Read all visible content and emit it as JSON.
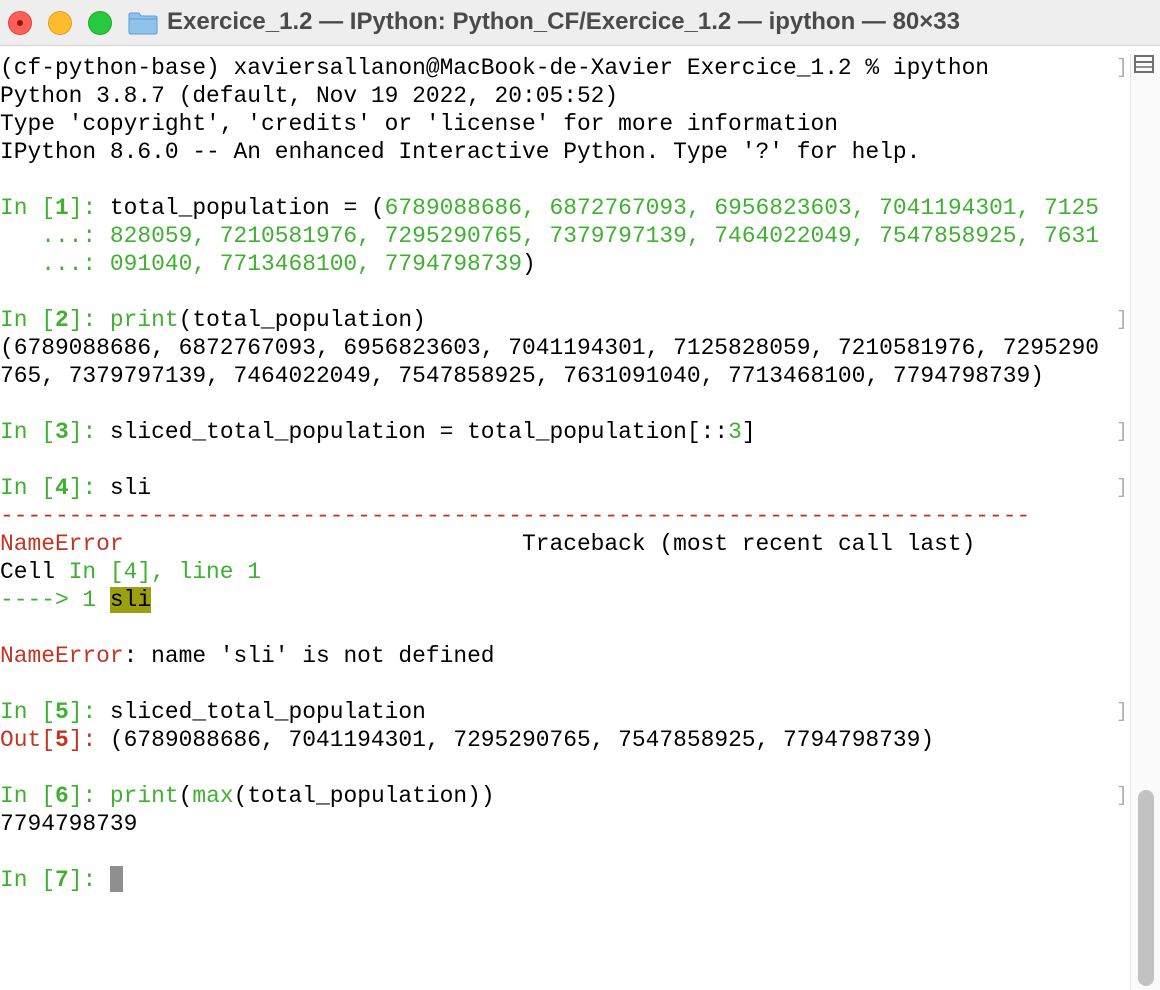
{
  "window": {
    "title": "Exercice_1.2 — IPython: Python_CF/Exercice_1.2 — ipython — 80×33"
  },
  "terminal": {
    "shell_prompt": "(cf-python-base) xaviersallanon@MacBook-de-Xavier Exercice_1.2 % ipython",
    "banner": [
      "Python 3.8.7 (default, Nov 19 2022, 20:05:52)",
      "Type 'copyright', 'credits' or 'license' for more information",
      "IPython 8.6.0 -- An enhanced Interactive Python. Type '?' for help."
    ],
    "cell1": {
      "prompt_in": "In [",
      "number": "1",
      "prompt_close": "]: ",
      "code1_pre": "total_population = (",
      "code1_nums": "6789088686, 6872767093, 6956823603, 7041194301, 7125",
      "cont_prompt": "   ...: ",
      "code2": "828059, 7210581976, 7295290765, 7379797139, 7464022049, 7547858925, 7631",
      "code3_nums": "091040, 7713468100, 7794798739",
      "code3_post": ")"
    },
    "cell2": {
      "prompt_in": "In [",
      "number": "2",
      "prompt_close": "]: ",
      "code_func": "print",
      "code_rest": "(total_population)",
      "output1": "(6789088686, 6872767093, 6956823603, 7041194301, 7125828059, 7210581976, 7295290",
      "output2": "765, 7379797139, 7464022049, 7547858925, 7631091040, 7713468100, 7794798739)"
    },
    "cell3": {
      "prompt_in": "In [",
      "number": "3",
      "prompt_close": "]: ",
      "code_pre": "sliced_total_population = total_population[::",
      "code_num": "3",
      "code_post": "]"
    },
    "cell4": {
      "prompt_in": "In [",
      "number": "4",
      "prompt_close": "]: ",
      "code": "sli",
      "rule": "---------------------------------------------------------------------------",
      "error_name": "NameError",
      "traceback_header": "                             Traceback (most recent call last)",
      "cell_label": "Cell ",
      "cell_ref": "In [4], line 1",
      "arrow": "----> 1 ",
      "arrow_code": "sli",
      "error_colon": ":",
      "error_msg": " name 'sli' is not defined"
    },
    "cell5": {
      "prompt_in": "In [",
      "number": "5",
      "prompt_close": "]: ",
      "code": "sliced_total_population",
      "out_prefix": "Out[",
      "out_number": "5",
      "out_close": "]: ",
      "output": "(6789088686, 7041194301, 7295290765, 7547858925, 7794798739)"
    },
    "cell6": {
      "prompt_in": "In [",
      "number": "6",
      "prompt_close": "]: ",
      "code_func1": "print",
      "code_paren": "(",
      "code_func2": "max",
      "code_rest": "(total_population))",
      "output": "7794798739"
    },
    "cell7": {
      "prompt_in": "In [",
      "number": "7",
      "prompt_close": "]: "
    },
    "line_marker": "]"
  },
  "colors": {
    "prompt_green": "#3fb130",
    "error_red": "#c23621",
    "highlight": "#9ba010"
  }
}
